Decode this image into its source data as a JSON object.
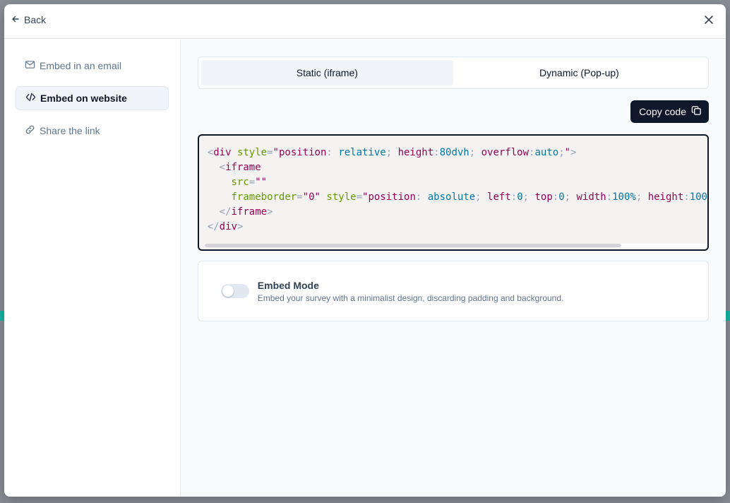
{
  "header": {
    "back_label": "Back"
  },
  "sidebar": {
    "items": [
      {
        "label": "Embed in an email",
        "icon": "mail-icon",
        "active": false
      },
      {
        "label": "Embed on website",
        "icon": "code-icon",
        "active": true
      },
      {
        "label": "Share the link",
        "icon": "link-icon",
        "active": false
      }
    ]
  },
  "tabs": [
    {
      "label": "Static (iframe)",
      "active": true
    },
    {
      "label": "Dynamic (Pop-up)",
      "active": false
    }
  ],
  "copy_button": {
    "label": "Copy code"
  },
  "code": {
    "lines": [
      "<div style=\"position: relative; height:80dvh; overflow:auto;\">",
      "  <iframe",
      "    src=\"\"",
      "    frameborder=\"0\" style=\"position: absolute; left:0; top:0; width:100%; height:100",
      "  </iframe>",
      "</div>"
    ]
  },
  "embed_mode": {
    "title": "Embed Mode",
    "description": "Embed your survey with a minimalist design, discarding padding and background.",
    "enabled": false
  },
  "colors": {
    "primary_button": "#0f172a",
    "accent_backdrop": "#14b8a6",
    "content_bg": "#f8fafc"
  }
}
